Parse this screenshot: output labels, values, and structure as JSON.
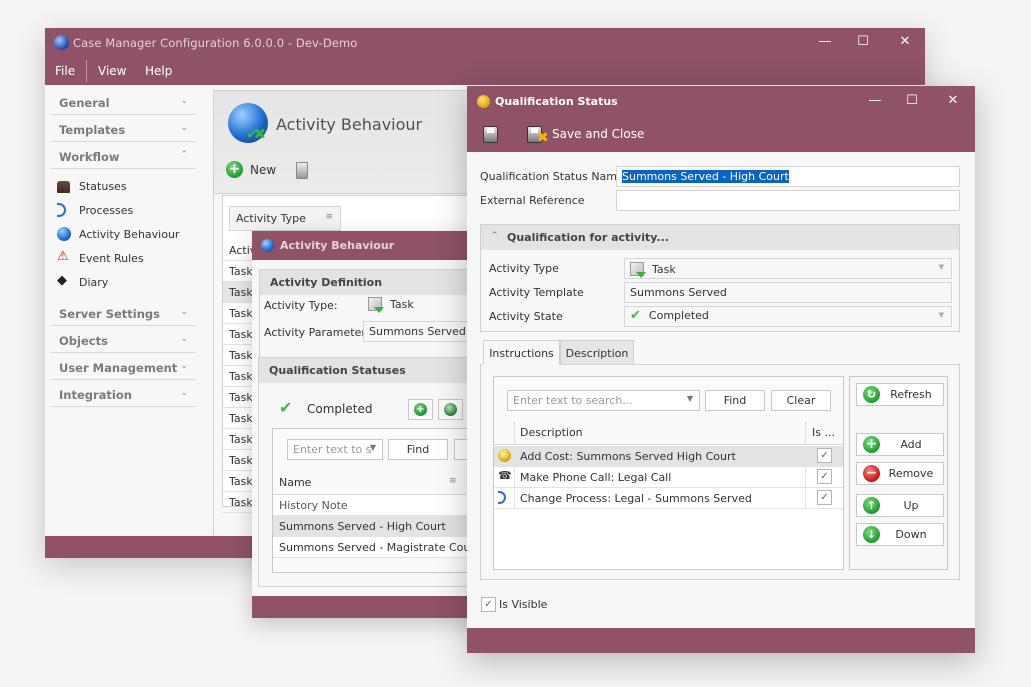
{
  "main_window": {
    "title": "Case Manager Configuration 6.0.0.0 - Dev-Demo",
    "controls": {
      "minimize": "—",
      "maximize": "☐",
      "close": "✕"
    },
    "menu": [
      "File",
      "View",
      "Help"
    ]
  },
  "sidebar": {
    "groups": [
      {
        "label": "General",
        "chevron": "⌄"
      },
      {
        "label": "Templates",
        "chevron": "⌄"
      },
      {
        "label": "Workflow",
        "chevron": "⌃"
      },
      {
        "label": "Server Settings",
        "chevron": "⌄"
      },
      {
        "label": "Objects",
        "chevron": "⌄"
      },
      {
        "label": "User Management",
        "chevron": "⌄"
      },
      {
        "label": "Integration",
        "chevron": "⌄"
      }
    ],
    "workflow_items": [
      {
        "label": "Statuses",
        "icon": "stamp-icon"
      },
      {
        "label": "Processes",
        "icon": "process-icon"
      },
      {
        "label": "Activity Behaviour",
        "icon": "globe-icon"
      },
      {
        "label": "Event Rules",
        "icon": "warning-icon"
      },
      {
        "label": "Diary",
        "icon": "diary-icon"
      }
    ]
  },
  "content": {
    "title": "Activity Behaviour",
    "new_label": "New",
    "group_chip": "Activity Type",
    "rows": [
      "Activ",
      "Task:",
      "Task:",
      "Task:",
      "Task:",
      "Task:",
      "Task:",
      "Task:",
      "Task:",
      "Task:",
      "Task:",
      "Task:",
      "Task:"
    ]
  },
  "activity_dialog": {
    "title": "Activity Behaviour",
    "definition_header": "Activity Definition",
    "activity_type_label": "Activity Type:",
    "activity_type_value": "Task",
    "activity_param_label": "Activity Parameter:",
    "activity_param_value": "Summons Served",
    "qual_header": "Qualification Statuses",
    "state_label": "Completed",
    "search_placeholder": "Enter text to s",
    "find_label": "Find",
    "grid_header": "Name",
    "rows": [
      "History Note",
      "Summons Served - High Court",
      "Summons Served - Magistrate Court"
    ]
  },
  "qs_dialog": {
    "title": "Qualification Status",
    "controls": {
      "minimize": "—",
      "maximize": "☐",
      "close": "✕"
    },
    "save_close_label": "Save and Close",
    "name_label": "Qualification Status Name",
    "name_value": "Summons Served - High Court",
    "ext_ref_label": "External Reference",
    "ext_ref_value": "",
    "qual_header": "Qualification for activity...",
    "activity_type_label": "Activity Type",
    "activity_type_value": "Task",
    "activity_template_label": "Activity Template",
    "activity_template_value": "Summons Served",
    "activity_state_label": "Activity State",
    "activity_state_value": "Completed",
    "tabs": [
      "Instructions",
      "Description"
    ],
    "active_tab": "Instructions",
    "search_placeholder": "Enter text to search...",
    "find_label": "Find",
    "clear_label": "Clear",
    "grid_headers": [
      "Description",
      "Is ..."
    ],
    "rows": [
      {
        "icon": "coin-icon",
        "description": "Add Cost: Summons Served High Court",
        "checked": true
      },
      {
        "icon": "phone-icon",
        "description": "Make Phone Call: Legal Call",
        "checked": true
      },
      {
        "icon": "process-icon",
        "description": "Change Process: Legal - Summons Served",
        "checked": true
      }
    ],
    "side_buttons": [
      "Refresh",
      "Add",
      "Remove",
      "Up",
      "Down"
    ],
    "is_visible_label": "Is Visible",
    "is_visible_checked": true
  },
  "colors": {
    "brand": "#8f5267",
    "selection": "#0a64c8"
  }
}
